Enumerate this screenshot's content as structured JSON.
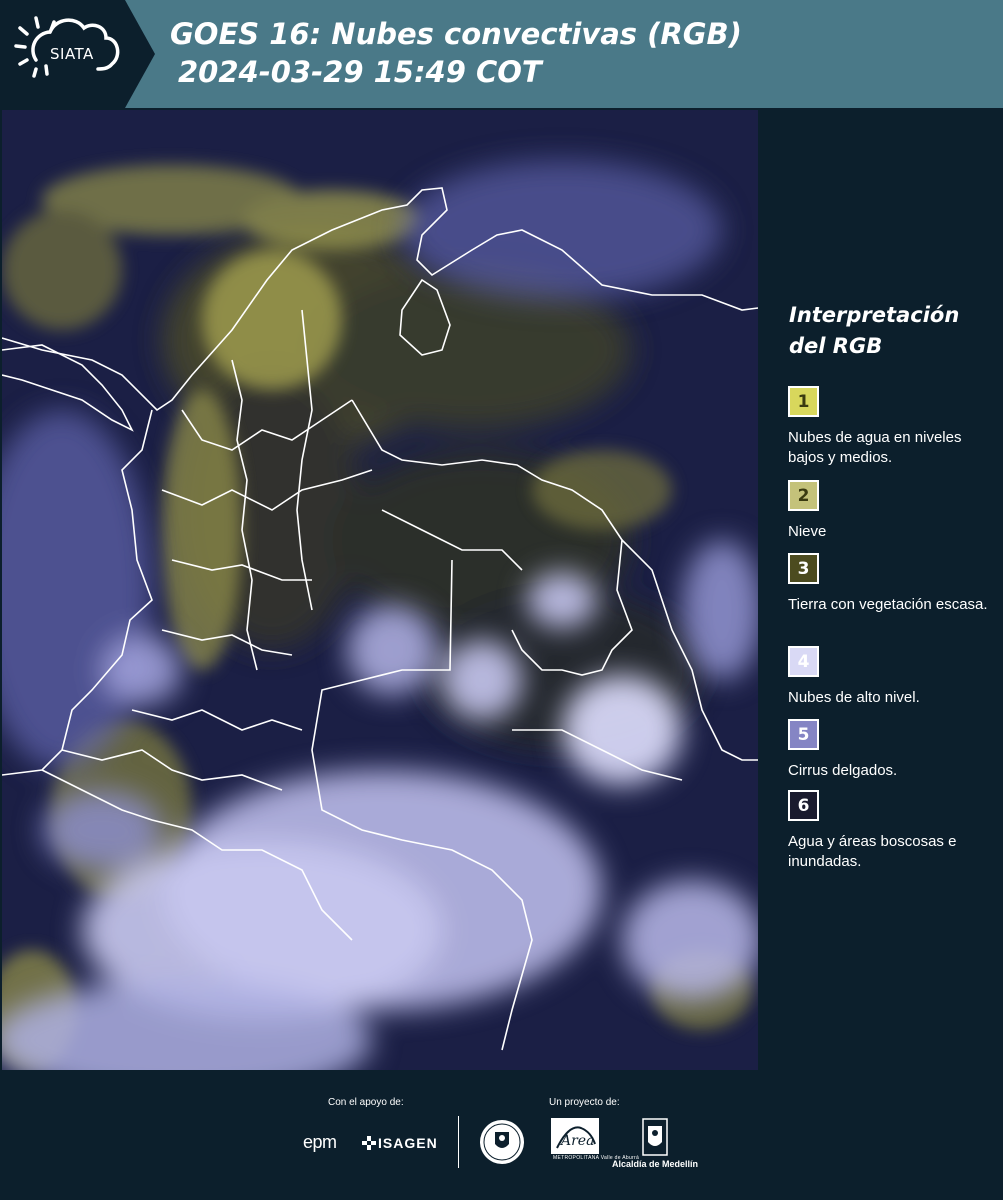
{
  "header": {
    "logo_text": "SIATA",
    "title": "GOES 16: Nubes convectivas (RGB)",
    "subtitle": "2024-03-29 15:49 COT"
  },
  "legend": {
    "title": "Interpretación del RGB",
    "items": [
      {
        "number": "1",
        "label": "Nubes de agua en niveles bajos y medios.",
        "color": "#d8d75c",
        "text_color": "#3a3a10"
      },
      {
        "number": "2",
        "label": "Nieve",
        "color": "#c4c27a",
        "text_color": "#3a3a10"
      },
      {
        "number": "3",
        "label": "Tierra con vegetación escasa.",
        "color": "#4c4b1f",
        "text_color": "#ffffff"
      },
      {
        "number": "4",
        "label": "Nubes de alto nivel.",
        "color": "#d9d9f5",
        "text_color": "#ffffff"
      },
      {
        "number": "5",
        "label": "Cirrus delgados.",
        "color": "#8585c4",
        "text_color": "#ffffff"
      },
      {
        "number": "6",
        "label": "Agua y áreas boscosas e inundadas.",
        "color": "#1a1b2e",
        "text_color": "#ffffff"
      }
    ]
  },
  "footer": {
    "support_label": "Con el apoyo de:",
    "project_label": "Un proyecto de:",
    "sponsor_1": "epm",
    "sponsor_2": "ISAGEN",
    "partner_area": "METROPOLITANA Valle de Aburrá",
    "partner_alcaldia": "Alcaldía de Medellín"
  },
  "colors": {
    "header_bg": "#4a7988",
    "panel_bg": "#0c1f2c",
    "cloud_high": "#d4d4f2",
    "cloud_low": "#cfcd6a",
    "background_dark": "#1b1f45"
  }
}
